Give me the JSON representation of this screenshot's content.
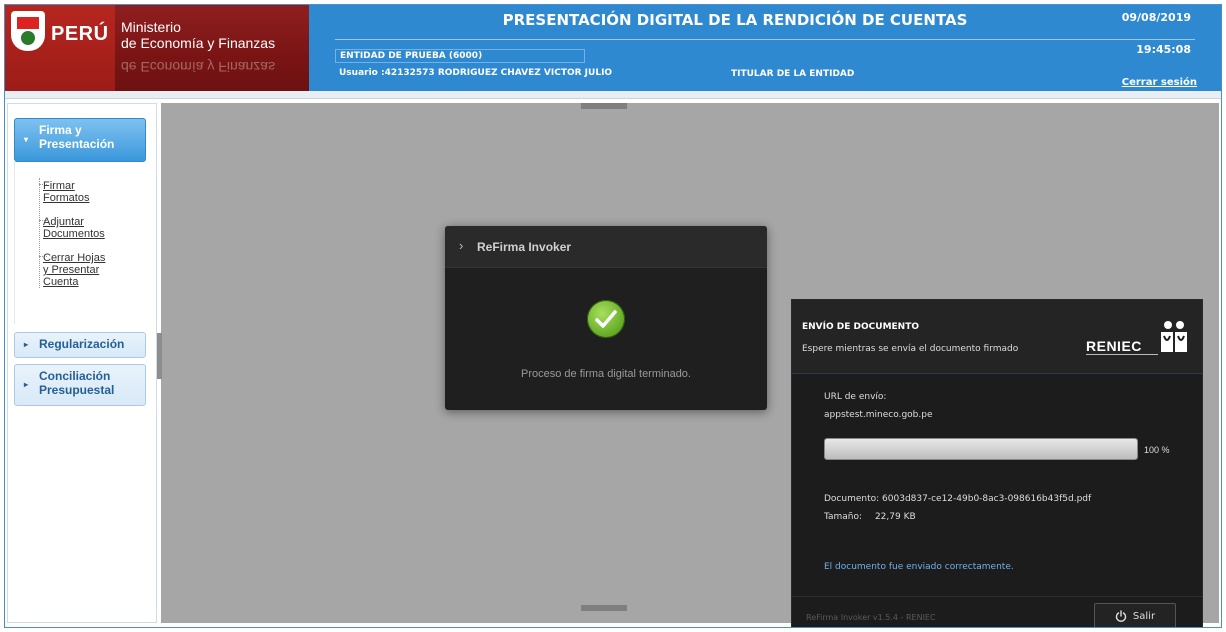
{
  "header": {
    "logo_country": "PERÚ",
    "ministry_line1": "Ministerio",
    "ministry_line2": "de Economía y Finanzas",
    "title": "PRESENTACIÓN DIGITAL DE LA RENDICIÓN DE CUENTAS",
    "date": "09/08/2019",
    "time": "19:45:08",
    "entity": "ENTIDAD DE PRUEBA (6000)",
    "user": "Usuario :42132573  RODRIGUEZ  CHAVEZ VICTOR JULIO",
    "role": "TITULAR DE LA ENTIDAD",
    "logout": "Cerrar sesión"
  },
  "sidebar": {
    "sections": [
      {
        "label": "Firma y Presentación",
        "expanded": true
      },
      {
        "label": "Regularización",
        "expanded": false
      },
      {
        "label": "Conciliación Presupuestal",
        "expanded": false
      }
    ],
    "items": [
      {
        "label": "Firmar Formatos"
      },
      {
        "label": "Adjuntar Documentos"
      },
      {
        "label": "Cerrar Hojas y Presentar Cuenta"
      }
    ]
  },
  "dialog": {
    "title": "ReFirma Invoker",
    "message": "Proceso de firma digital terminado."
  },
  "reniec_panel": {
    "title": "ENVÍO DE DOCUMENTO",
    "subtitle": "Espere mientras se envía el documento firmado",
    "logo_text": "RENIEC",
    "url_label": "URL de envío:",
    "url_value": "appstest.mineco.gob.pe",
    "progress_value": 100,
    "progress_text": "100 %",
    "document_label": "Documento:",
    "document_value": "6003d837-ce12-49b0-8ac3-098616b43f5d.pdf",
    "size_label": "Tamaño:",
    "size_value": "22,79 KB",
    "success_message": "El documento fue enviado correctamente.",
    "version": "ReFirma Invoker v1.5.4 - RENIEC",
    "exit_button": "Salir"
  },
  "colors": {
    "header_blue": "#2e89d1",
    "ministry_red": "#7a1414",
    "active_section": "#3b98db",
    "success_green": "#62a924",
    "success_text": "#6fb0ea"
  },
  "icons": [
    "peru-shield-icon",
    "chevron-right-icon",
    "check-circle-icon",
    "reniec-logo-icon",
    "power-icon",
    "caret-down-icon",
    "caret-right-icon"
  ]
}
